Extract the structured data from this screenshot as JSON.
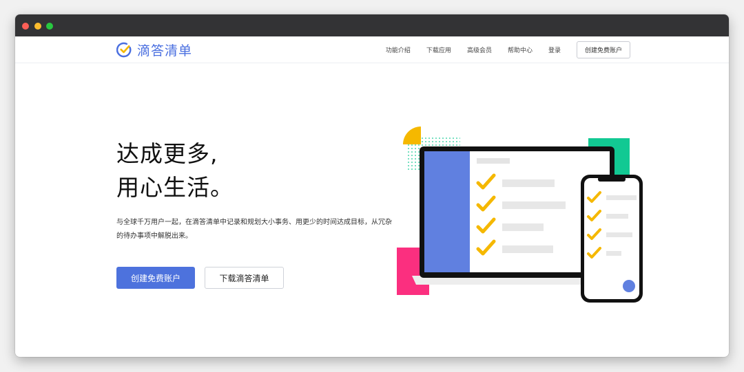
{
  "nav": {
    "logo_text": "滴答清单",
    "links": [
      "功能介绍",
      "下载应用",
      "高级会员",
      "帮助中心",
      "登录"
    ],
    "cta": "创建免费账户"
  },
  "hero": {
    "title_line1": "达成更多,",
    "title_line2": "用心生活。",
    "description": "与全球千万用户一起，在滴答清单中记录和规划大小事务、用更少的时间达成目标，从冗杂的待办事项中解脱出来。",
    "primary_button": "创建免费账户",
    "secondary_button": "下载滴答清单"
  },
  "colors": {
    "brand_blue": "#4d72dd",
    "check_yellow": "#f5b800",
    "accent_green": "#12c993",
    "accent_pink": "#fb2f7f"
  }
}
